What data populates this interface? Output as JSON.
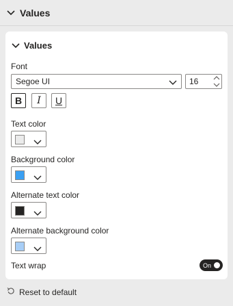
{
  "section": {
    "title": "Values"
  },
  "card": {
    "title": "Values",
    "font_label": "Font",
    "font_family": "Segoe UI",
    "font_size": "16",
    "bold_label": "B",
    "italic_label": "I",
    "underline_label": "U",
    "text_color_label": "Text color",
    "text_color": "#ebebeb",
    "background_color_label": "Background color",
    "background_color": "#3aa0f3",
    "alt_text_color_label": "Alternate text color",
    "alt_text_color": "#252423",
    "alt_background_color_label": "Alternate background color",
    "alt_background_color": "#a8cef6",
    "text_wrap_label": "Text wrap",
    "text_wrap_toggle": "On"
  },
  "footer": {
    "reset_label": "Reset to default"
  },
  "icons": {
    "section_chevron": "chevron-down-icon",
    "card_chevron": "chevron-down-icon",
    "reset": "reset-icon"
  }
}
